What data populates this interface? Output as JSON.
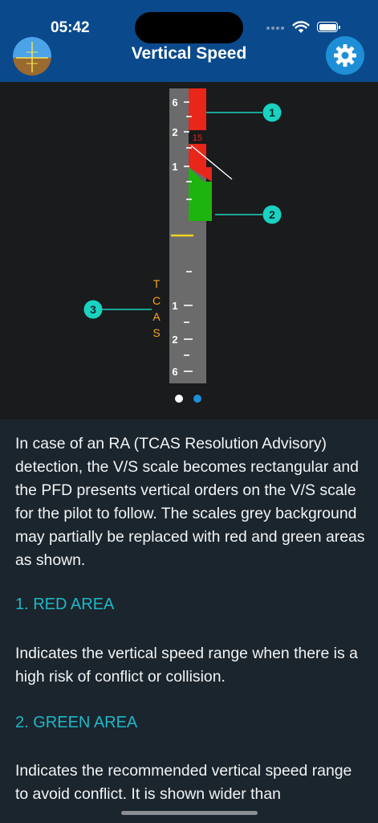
{
  "status_bar": {
    "time": "05:42"
  },
  "header": {
    "title": "Vertical Speed"
  },
  "diagram": {
    "scale_labels_top": [
      "6",
      "2",
      "1"
    ],
    "scale_labels_bottom": [
      "1",
      "2",
      "6"
    ],
    "ra_value": "15",
    "tcas_label": [
      "T",
      "C",
      "A",
      "S"
    ],
    "callouts": [
      "1",
      "2",
      "3"
    ],
    "colors": {
      "red_area": "#e8261a",
      "green_area": "#1eb40f",
      "callout": "#19d3c0",
      "tcas": "#f5a623",
      "scale": "#6b6b6b"
    }
  },
  "pager": {
    "pages": 2,
    "active": 2
  },
  "content": {
    "intro": "In case of an RA (TCAS Resolution Advisory) detection, the V/S scale becomes rectangular and the PFD presents vertical orders on the V/S scale for the pilot to follow. The scales grey background may partially be replaced with red and green areas as shown.",
    "section1_heading": "1. RED AREA",
    "section1_text": "Indicates the vertical speed range when there is a high risk of conflict or collision.",
    "section2_heading": "2. GREEN AREA",
    "section2_text": "Indicates the recommended vertical speed range to avoid conflict. It is shown wider than"
  }
}
